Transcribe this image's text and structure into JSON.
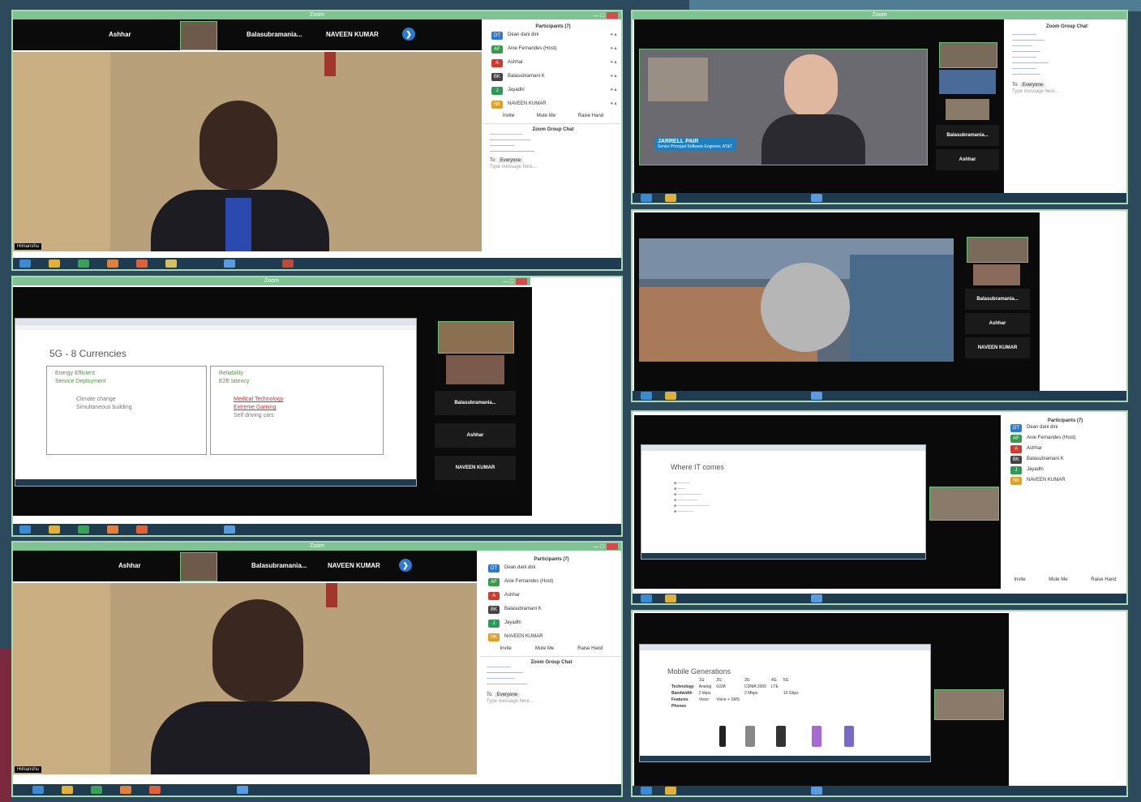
{
  "colors": {
    "zoom_green": "#7fc294",
    "badge_blue": "#1d7fbf",
    "close_red": "#d84a4a",
    "taskbar": "#1e3b50"
  },
  "top_strip_a": {
    "names": [
      "Ashhar",
      "Balasubramania...",
      "NAVEEN KUMAR"
    ]
  },
  "top_strip_b": {
    "names": [
      "Ashhar",
      "Balasubramania...",
      "NAVEEN KUMAR"
    ]
  },
  "window_title": "Zoom",
  "participants_panel": {
    "title": "Participants (7)",
    "people": [
      {
        "initials": "DT",
        "color": "#2e7ad1",
        "name": "Dean dani dini"
      },
      {
        "initials": "AF",
        "color": "#3a9a4a",
        "name": "Anie Fernandes (Host)"
      },
      {
        "initials": "A",
        "color": "#d13a2e",
        "name": "Ashhar"
      },
      {
        "initials": "BK",
        "color": "#444444",
        "name": "Balasubramani K"
      },
      {
        "initials": "J",
        "color": "#2e9a5a",
        "name": "Jayadhi"
      },
      {
        "initials": "NK",
        "color": "#e0a020",
        "name": "NAVEEN KUMAR"
      }
    ],
    "buttons": [
      "Invite",
      "Mute Me",
      "Raise Hand"
    ]
  },
  "chat": {
    "title": "Zoom Group Chat",
    "to_label": "To:",
    "to_value": "Everyone",
    "placeholder": "Type message here..."
  },
  "slide_5g": {
    "title": "5G - 8 Currencies",
    "left_green": [
      "Energy Efficient",
      "Service Deployment"
    ],
    "left_gray": [
      "Climate change",
      "Simultaneous building"
    ],
    "right_green": [
      "Reliability",
      "E2E latency"
    ],
    "right_red": [
      "Medical Technology",
      "Extreme Gaming"
    ],
    "right_gray": [
      "Self driving cars"
    ]
  },
  "slide_iot": {
    "title": "Where IT comes"
  },
  "slide_mobile": {
    "title": "Mobile Generations",
    "generations": [
      "1G",
      "2G",
      "3G",
      "4G",
      "5G"
    ],
    "rows": [
      {
        "label": "Technology",
        "cells": [
          "Analog",
          "GSM",
          "CDMA 2000",
          "LTE",
          ""
        ]
      },
      {
        "label": "Bandwidth",
        "cells": [
          "2 kbps",
          "",
          "2 Mbps",
          "",
          "10 Gbps"
        ]
      },
      {
        "label": "Features",
        "cells": [
          "Voice",
          "Voice + SMS",
          "",
          "",
          ""
        ]
      },
      {
        "label": "Phones",
        "cells": [
          "",
          "",
          "",
          "",
          ""
        ]
      }
    ]
  },
  "jarrell": {
    "name": "JARRELL PAIR",
    "title": "Senior Principal Software Engineer, AT&T"
  },
  "surgery_side": [
    "Balasubramania...",
    "Ashhar",
    "NAVEEN KUMAR"
  ],
  "slide_side": [
    "Balasubramania...",
    "Ashhar",
    "NAVEEN KUMAR"
  ]
}
